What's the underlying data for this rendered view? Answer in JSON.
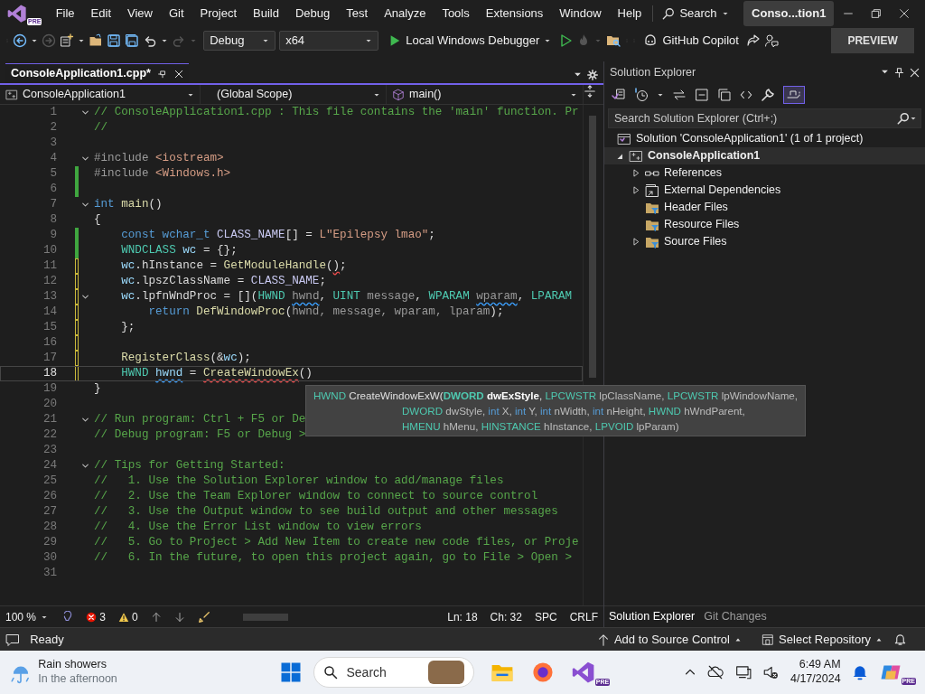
{
  "menu_bar": {
    "logo_badge": "PRE",
    "items": [
      "File",
      "Edit",
      "View",
      "Git",
      "Project",
      "Build",
      "Debug",
      "Test",
      "Analyze",
      "Tools",
      "Extensions",
      "Window",
      "Help"
    ],
    "search": "Search",
    "title": "Conso...tion1"
  },
  "toolbar": {
    "configuration": "Debug",
    "platform": "x64",
    "debugger": "Local Windows Debugger",
    "copilot": "GitHub Copilot",
    "preview": "PREVIEW"
  },
  "editor": {
    "tabs": [
      {
        "label": "ConsoleApplication1.cpp*",
        "selected": true
      }
    ],
    "project": "ConsoleApplication1",
    "scope": "(Global Scope)",
    "member": "main()",
    "lines": [
      {
        "n": "1",
        "collapsible": true,
        "changed": false,
        "current": false,
        "tokens": [
          {
            "t": "// ConsoleApplication1.cpp : This file contains the 'main' function. Pr",
            "kind": "comment"
          }
        ]
      },
      {
        "n": "2",
        "collapsible": false,
        "changed": false,
        "current": false,
        "tokens": [
          {
            "t": "//",
            "kind": "comment"
          }
        ]
      },
      {
        "n": "3",
        "collapsible": false,
        "changed": false,
        "current": false
      },
      {
        "n": "4",
        "collapsible": true,
        "changed": false,
        "current": false,
        "tokens": [
          {
            "t": "#include ",
            "kind": "directive"
          },
          {
            "t": "<iostream>",
            "kind": "string"
          }
        ]
      },
      {
        "n": "5",
        "collapsible": false,
        "changed": true,
        "saved": true,
        "current": false,
        "tokens": [
          {
            "t": "#include ",
            "kind": "directive"
          },
          {
            "t": "<Windows.h>",
            "kind": "string"
          }
        ]
      },
      {
        "n": "6",
        "collapsible": false,
        "changed": true,
        "saved": true,
        "current": false
      },
      {
        "n": "7",
        "collapsible": true,
        "changed": false,
        "current": false,
        "tokens": [
          {
            "t": "int ",
            "kind": "keyword"
          },
          {
            "t": "main",
            "kind": "function"
          },
          {
            "t": "()"
          }
        ]
      },
      {
        "n": "8",
        "collapsible": false,
        "changed": false,
        "current": false,
        "tokens": [
          {
            "t": "{"
          }
        ]
      },
      {
        "n": "9",
        "collapsible": false,
        "changed": true,
        "saved": true,
        "current": false,
        "tokens": [
          {
            "t": "    const wchar_t",
            "kind": "keyword"
          },
          {
            "t": " CLASS_NAME",
            "kind": "macro"
          },
          {
            "t": "[] = "
          },
          {
            "t": "L\"Epilepsy lmao\"",
            "kind": "string"
          },
          {
            "t": ";"
          }
        ]
      },
      {
        "n": "10",
        "collapsible": false,
        "changed": true,
        "saved": true,
        "current": false,
        "tokens": [
          {
            "t": "    WNDCLASS",
            "kind": "type"
          },
          {
            "t": " wc",
            "kind": "variable"
          },
          {
            "t": " = {};"
          }
        ]
      },
      {
        "n": "11",
        "collapsible": false,
        "changed": true,
        "saved": false,
        "current": false,
        "tokens": [
          {
            "t": "    wc",
            "kind": "variable"
          },
          {
            "t": ".hInstance = "
          },
          {
            "t": "GetModuleHandle",
            "kind": "function"
          },
          {
            "t": "("
          },
          {
            "t": ")",
            "error": true
          },
          {
            "t": ";"
          }
        ]
      },
      {
        "n": "12",
        "collapsible": false,
        "changed": true,
        "saved": false,
        "current": false,
        "tokens": [
          {
            "t": "    wc",
            "kind": "variable"
          },
          {
            "t": ".lpszClassName = "
          },
          {
            "t": "CLASS_NAME",
            "kind": "macro"
          },
          {
            "t": ";"
          }
        ]
      },
      {
        "n": "13",
        "collapsible": true,
        "changed": true,
        "saved": false,
        "current": false,
        "tokens": [
          {
            "t": "    wc",
            "kind": "variable"
          },
          {
            "t": ".lpfnWndProc = []("
          },
          {
            "t": "HWND ",
            "kind": "type"
          },
          {
            "t": "hwnd",
            "kind": "parameter",
            "warning": true
          },
          {
            "t": ", "
          },
          {
            "t": "UINT ",
            "kind": "type"
          },
          {
            "t": "message",
            "kind": "parameter"
          },
          {
            "t": ", "
          },
          {
            "t": "WPARAM ",
            "kind": "type"
          },
          {
            "t": "wparam",
            "kind": "parameter",
            "warning": true
          },
          {
            "t": ", "
          },
          {
            "t": "LPARAM",
            "kind": "type"
          }
        ]
      },
      {
        "n": "14",
        "collapsible": false,
        "changed": true,
        "saved": false,
        "current": false,
        "tokens": [
          {
            "t": "        return",
            "kind": "keyword"
          },
          {
            "t": " DefWindowProc",
            "kind": "function"
          },
          {
            "t": "("
          },
          {
            "t": "hwnd, message, wparam, lparam",
            "kind": "parameter"
          },
          {
            "t": ");"
          }
        ]
      },
      {
        "n": "15",
        "collapsible": false,
        "changed": true,
        "saved": false,
        "current": false,
        "tokens": [
          {
            "t": "    };"
          }
        ]
      },
      {
        "n": "16",
        "collapsible": false,
        "changed": true,
        "saved": false,
        "current": false
      },
      {
        "n": "17",
        "collapsible": false,
        "changed": true,
        "saved": false,
        "current": false,
        "tokens": [
          {
            "t": "    RegisterClass",
            "kind": "function"
          },
          {
            "t": "(&"
          },
          {
            "t": "wc",
            "kind": "variable"
          },
          {
            "t": ");"
          }
        ]
      },
      {
        "n": "18",
        "collapsible": false,
        "changed": true,
        "saved": false,
        "current": true,
        "tokens": [
          {
            "t": "    HWND ",
            "kind": "type"
          },
          {
            "t": "hwnd",
            "kind": "variable",
            "warning": true
          },
          {
            "t": " = "
          },
          {
            "t": "CreateWindowEx",
            "kind": "function",
            "error": true
          },
          {
            "t": "()"
          }
        ]
      },
      {
        "n": "19",
        "collapsible": false,
        "changed": false,
        "current": false,
        "tokens": [
          {
            "t": "}"
          }
        ]
      },
      {
        "n": "20",
        "collapsible": false,
        "changed": false,
        "current": false
      },
      {
        "n": "21",
        "collapsible": true,
        "changed": false,
        "current": false,
        "tokens": [
          {
            "t": "// Run program: Ctrl + F5 or De",
            "kind": "comment"
          }
        ]
      },
      {
        "n": "22",
        "collapsible": false,
        "changed": false,
        "current": false,
        "tokens": [
          {
            "t": "// Debug program: F5 or Debug >",
            "kind": "comment"
          }
        ]
      },
      {
        "n": "23",
        "collapsible": false,
        "changed": false,
        "current": false
      },
      {
        "n": "24",
        "collapsible": true,
        "changed": false,
        "current": false,
        "tokens": [
          {
            "t": "// Tips for Getting Started:",
            "kind": "comment"
          }
        ]
      },
      {
        "n": "25",
        "collapsible": false,
        "changed": false,
        "current": false,
        "tokens": [
          {
            "t": "//   1. Use the Solution Explorer window to add/manage files",
            "kind": "comment"
          }
        ]
      },
      {
        "n": "26",
        "collapsible": false,
        "changed": false,
        "current": false,
        "tokens": [
          {
            "t": "//   2. Use the Team Explorer window to connect to source control",
            "kind": "comment"
          }
        ]
      },
      {
        "n": "27",
        "collapsible": false,
        "changed": false,
        "current": false,
        "tokens": [
          {
            "t": "//   3. Use the Output window to see build output and other messages",
            "kind": "comment"
          }
        ]
      },
      {
        "n": "28",
        "collapsible": false,
        "changed": false,
        "current": false,
        "tokens": [
          {
            "t": "//   4. Use the Error List window to view errors",
            "kind": "comment"
          }
        ]
      },
      {
        "n": "29",
        "collapsible": false,
        "changed": false,
        "current": false,
        "tokens": [
          {
            "t": "//   5. Go to Project > Add New Item to create new code files, or Proje",
            "kind": "comment"
          }
        ]
      },
      {
        "n": "30",
        "collapsible": false,
        "changed": false,
        "current": false,
        "tokens": [
          {
            "t": "//   6. In the future, to open this project again, go to File > Open >",
            "kind": "comment"
          }
        ]
      },
      {
        "n": "31",
        "collapsible": false,
        "changed": false,
        "current": false
      }
    ],
    "tooltip": [
      [
        {
          "t": "HWND",
          "kind": "type"
        },
        {
          "t": " CreateWindowExW("
        },
        {
          "t": "DWORD",
          "kind": "type",
          "current": true
        },
        {
          "t": " dwExStyle",
          "current": true
        },
        {
          "t": ", "
        },
        {
          "t": "LPCWSTR",
          "kind": "type"
        },
        {
          "t": " lpClassName, ",
          "kind": "parameter"
        },
        {
          "t": "LPCWSTR",
          "kind": "type"
        },
        {
          "t": " lpWindowName,",
          "kind": "parameter"
        }
      ],
      [
        {
          "t": "DWORD",
          "kind": "type"
        },
        {
          "t": " dwStyle, ",
          "kind": "parameter"
        },
        {
          "t": "int",
          "kind": "keyword"
        },
        {
          "t": " X, ",
          "kind": "parameter"
        },
        {
          "t": "int",
          "kind": "keyword"
        },
        {
          "t": " Y, ",
          "kind": "parameter"
        },
        {
          "t": "int",
          "kind": "keyword"
        },
        {
          "t": " nWidth, ",
          "kind": "parameter"
        },
        {
          "t": "int",
          "kind": "keyword"
        },
        {
          "t": " nHeight, ",
          "kind": "parameter"
        },
        {
          "t": "HWND",
          "kind": "type"
        },
        {
          "t": " hWndParent,",
          "kind": "parameter"
        }
      ],
      [
        {
          "t": "HMENU",
          "kind": "type"
        },
        {
          "t": " hMenu, ",
          "kind": "parameter"
        },
        {
          "t": "HINSTANCE",
          "kind": "type"
        },
        {
          "t": " hInstance, ",
          "kind": "parameter"
        },
        {
          "t": "LPVOID",
          "kind": "type"
        },
        {
          "t": " lpParam)",
          "kind": "parameter"
        }
      ]
    ]
  },
  "editor_status": {
    "zoom": "100 %",
    "errors": "3",
    "warnings": "0",
    "line": "Ln: 18",
    "column": "Ch: 32",
    "whitespace": "SPC",
    "line_ending": "CRLF"
  },
  "solution_explorer": {
    "title": "Solution Explorer",
    "preview_toggle": {
      "on": true
    },
    "search": {
      "placeholder": "Search Solution Explorer (Ctrl+;)"
    },
    "solution": "Solution 'ConsoleApplication1' (1 of 1 project)",
    "project": {
      "label": "ConsoleApplication1",
      "expanded": true,
      "selected": true
    },
    "items": [
      {
        "label": "References",
        "kind": "references",
        "expandable": true
      },
      {
        "label": "External Dependencies",
        "kind": "dependencies",
        "expandable": true
      },
      {
        "label": "Header Files",
        "kind": "filter",
        "expandable": false
      },
      {
        "label": "Resource Files",
        "kind": "filter",
        "expandable": false
      },
      {
        "label": "Source Files",
        "kind": "filter",
        "expandable": true
      }
    ],
    "tabs": [
      {
        "label": "Solution Explorer",
        "selected": true
      },
      {
        "label": "Git Changes",
        "selected": false
      }
    ]
  },
  "status_bar": {
    "status": "Ready",
    "source_control": "Add to Source Control",
    "repository": "Select Repository"
  },
  "taskbar": {
    "weather": {
      "title": "Rain showers",
      "subtitle": "In the afternoon"
    },
    "search": {
      "placeholder": "Search"
    },
    "app_badge": "PRE",
    "copilot_badge": "PRE",
    "time": "6:49 AM",
    "date": "4/17/2024"
  }
}
